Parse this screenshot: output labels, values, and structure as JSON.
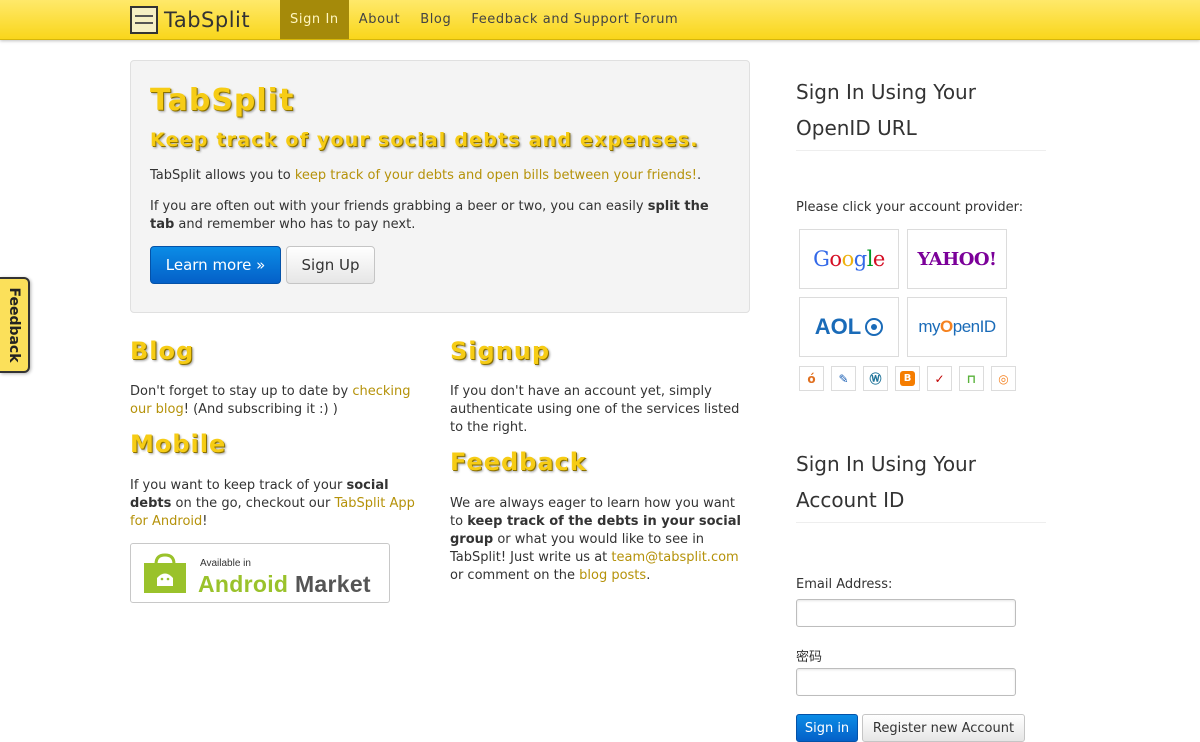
{
  "navbar": {
    "brand": "TabSplit",
    "items": [
      "Sign In",
      "About",
      "Blog",
      "Feedback and Support Forum"
    ]
  },
  "feedback_tab": "Feedback",
  "hero": {
    "title": "TabSplit",
    "tagline": "Keep track of your social debts and expenses.",
    "p1_before": "TabSplit allows you to ",
    "p1_link": "keep track of your debts and open bills between your friends!",
    "p1_after": ".",
    "p2_before": "If you are often out with your friends grabbing a beer or two, you can easily ",
    "p2_bold": "split the tab",
    "p2_after": " and remember who has to pay next.",
    "learn_more": "Learn more »",
    "sign_up": "Sign Up"
  },
  "blog": {
    "heading": "Blog",
    "before": "Don't forget to stay up to date by ",
    "link": "checking our blog",
    "after": "! (And subscribing it :) )"
  },
  "mobile": {
    "heading": "Mobile",
    "before": "If you want to keep track of your ",
    "bold": "social debts",
    "middle": " on the go, checkout our ",
    "link": "TabSplit App for Android",
    "after": "!",
    "badge_small": "Available in",
    "badge_green": "Android",
    "badge_dark": " Market"
  },
  "signup": {
    "heading": "Signup",
    "text": "If you don't have an account yet, simply authenticate using one of the services listed to the right."
  },
  "feedback": {
    "heading": "Feedback",
    "before": "We are always eager to learn how you want to ",
    "bold": "keep track of the debts in your social group",
    "middle": " or what you would like to see in TabSplit! Just write us at ",
    "email": "team@tabsplit.com",
    "middle2": " or comment on the ",
    "link": "blog posts",
    "after": "."
  },
  "sidebar": {
    "openid_heading": "Sign In Using Your OpenID URL",
    "provider_prompt": "Please click your account provider:",
    "providers_big": [
      "Google",
      "YAHOO!",
      "AOL",
      "myOpenID"
    ],
    "providers_small_icons": [
      "livejournal-icon",
      "pencil-icon",
      "wordpress-icon",
      "blogger-icon",
      "verisign-icon",
      "claimid-icon",
      "clickpass-icon"
    ],
    "account_heading": "Sign In Using Your Account ID",
    "email_label": "Email Address:",
    "password_label": "密码",
    "sign_in": "Sign in",
    "register": "Register new Account"
  },
  "colors": {
    "navbar": "#f9d61b",
    "nav_active": "#a58a0a",
    "heading_yellow": "#f6cc15",
    "link": "#b5920a",
    "primary": "#0460c8"
  }
}
